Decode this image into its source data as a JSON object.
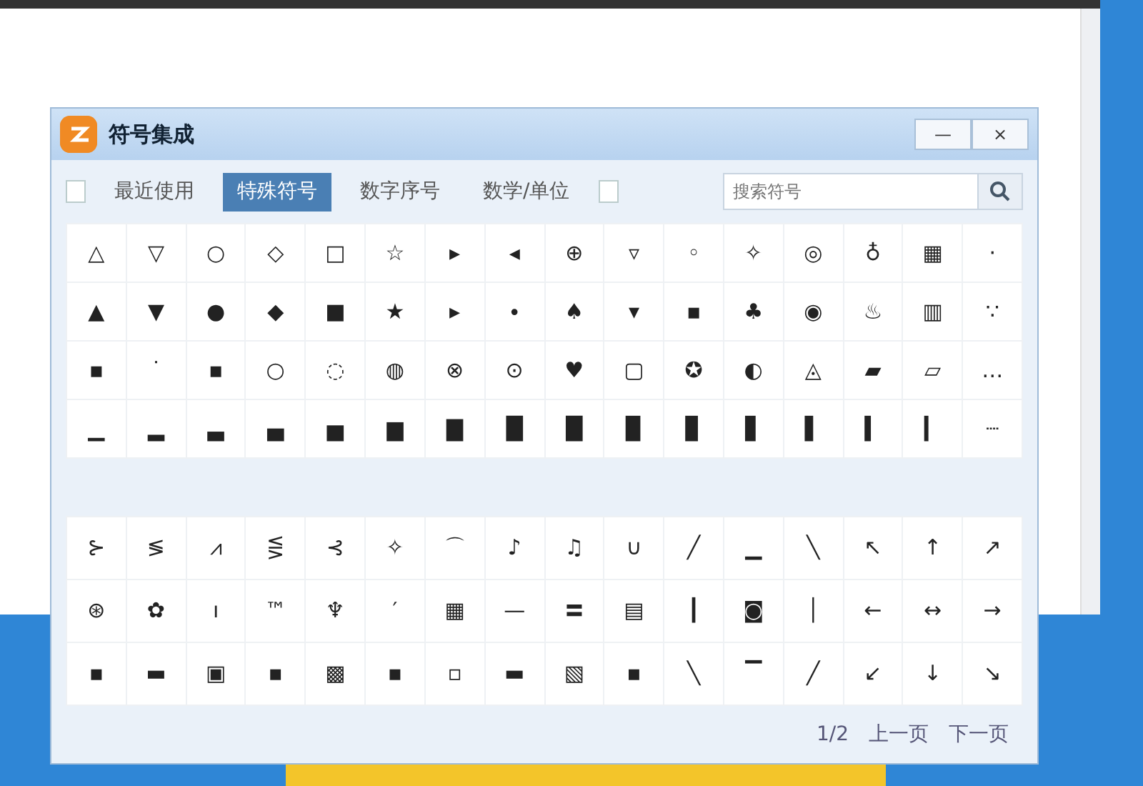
{
  "window": {
    "title": "符号集成",
    "controls": [
      "—",
      "×"
    ]
  },
  "tabs": [
    {
      "label": "最近使用",
      "selected": false
    },
    {
      "label": "特殊符号",
      "selected": true
    },
    {
      "label": "数字序号",
      "selected": false
    },
    {
      "label": "数学/单位",
      "selected": false
    }
  ],
  "search": {
    "placeholder": "搜索符号"
  },
  "grid_top": [
    [
      "△",
      "▽",
      "○",
      "◇",
      "□",
      "☆",
      "▸",
      "◂",
      "⊕",
      "▿",
      "◦",
      "✧",
      "◎",
      "♁",
      "▦",
      "·"
    ],
    [
      "▲",
      "▼",
      "●",
      "◆",
      "■",
      "★",
      "▸",
      "∙",
      "♠",
      "▾",
      "▪",
      "♣",
      "◉",
      "♨",
      "▥",
      "∵"
    ],
    [
      "▪",
      "˙",
      "▪",
      "○",
      "◌",
      "◍",
      "⊗",
      "⊙",
      "♥",
      "▢",
      "✪",
      "◐",
      "◬",
      "▰",
      "▱",
      "…"
    ],
    [
      "▁",
      "▂",
      "▃",
      "▄",
      "▅",
      "▆",
      "▇",
      "█",
      "█",
      "▉",
      "▊",
      "▋",
      "▌",
      "▍",
      "▎",
      "┈"
    ]
  ],
  "grid_bottom": [
    [
      "⊱",
      "≶",
      "⩘",
      "⋚",
      "⊰",
      "✧",
      "⌒",
      "♪",
      "♫",
      "∪",
      "╱",
      "▁",
      "╲",
      "↖",
      "↑",
      "↗"
    ],
    [
      "⊛",
      "✿",
      "ı",
      "™",
      "♆",
      "′",
      "▦",
      "—",
      "〓",
      "▤",
      "┃",
      "◙",
      "│",
      "←",
      "↔",
      "→"
    ],
    [
      "▪",
      "▬",
      "▣",
      "▪",
      "▩",
      "▪",
      "▫",
      "▬",
      "▧",
      "▪",
      "╲",
      "▔",
      "╱",
      "↙",
      "↓",
      "↘"
    ]
  ],
  "pager": {
    "page": "1/2",
    "prev": "上一页",
    "next": "下一页"
  }
}
